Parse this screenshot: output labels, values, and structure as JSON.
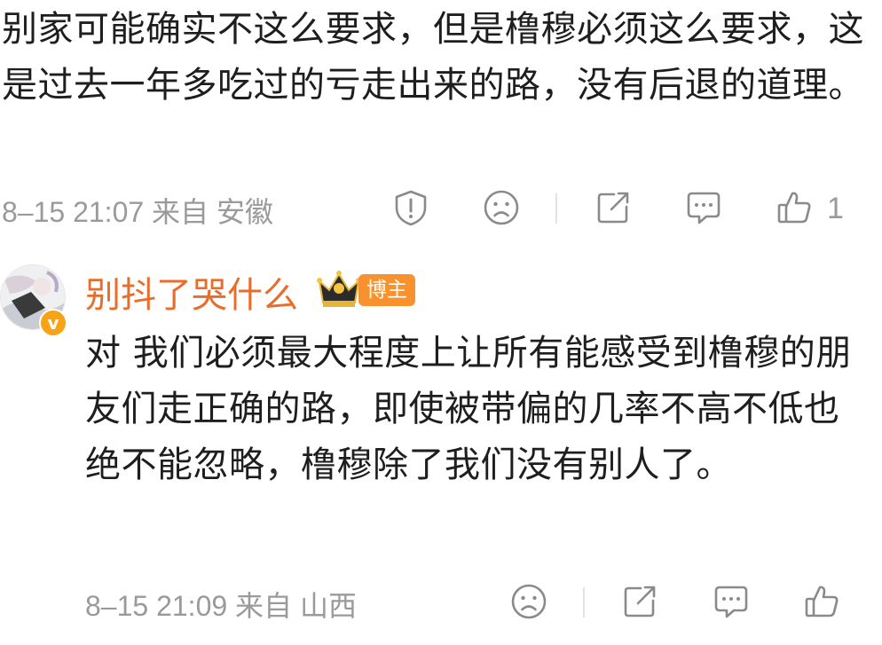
{
  "comment1": {
    "text": "别家可能确实不这么要求，但是橹穆必须这么要求，这是过去一年多吃过的亏走出来的路，没有后退的道理。",
    "meta": "8–15 21:07 来自 安徽",
    "like_count": "1"
  },
  "comment2": {
    "username": "别抖了哭什么",
    "badge": "博主",
    "text": "对 我们必须最大程度上让所有能感受到橹穆的朋友们走正确的路，即使被带偏的几率不高不低也绝不能忽略，橹穆除了我们没有别人了。",
    "meta": "8–15 21:09 来自 山西"
  },
  "icons": {
    "report": "report-icon",
    "dislike": "frown-icon",
    "share": "share-icon",
    "comment": "comment-icon",
    "like": "thumbs-up-icon"
  },
  "colors": {
    "username": "#e86d2b",
    "badge": "#f7922e",
    "meta": "#9a9a9a"
  }
}
